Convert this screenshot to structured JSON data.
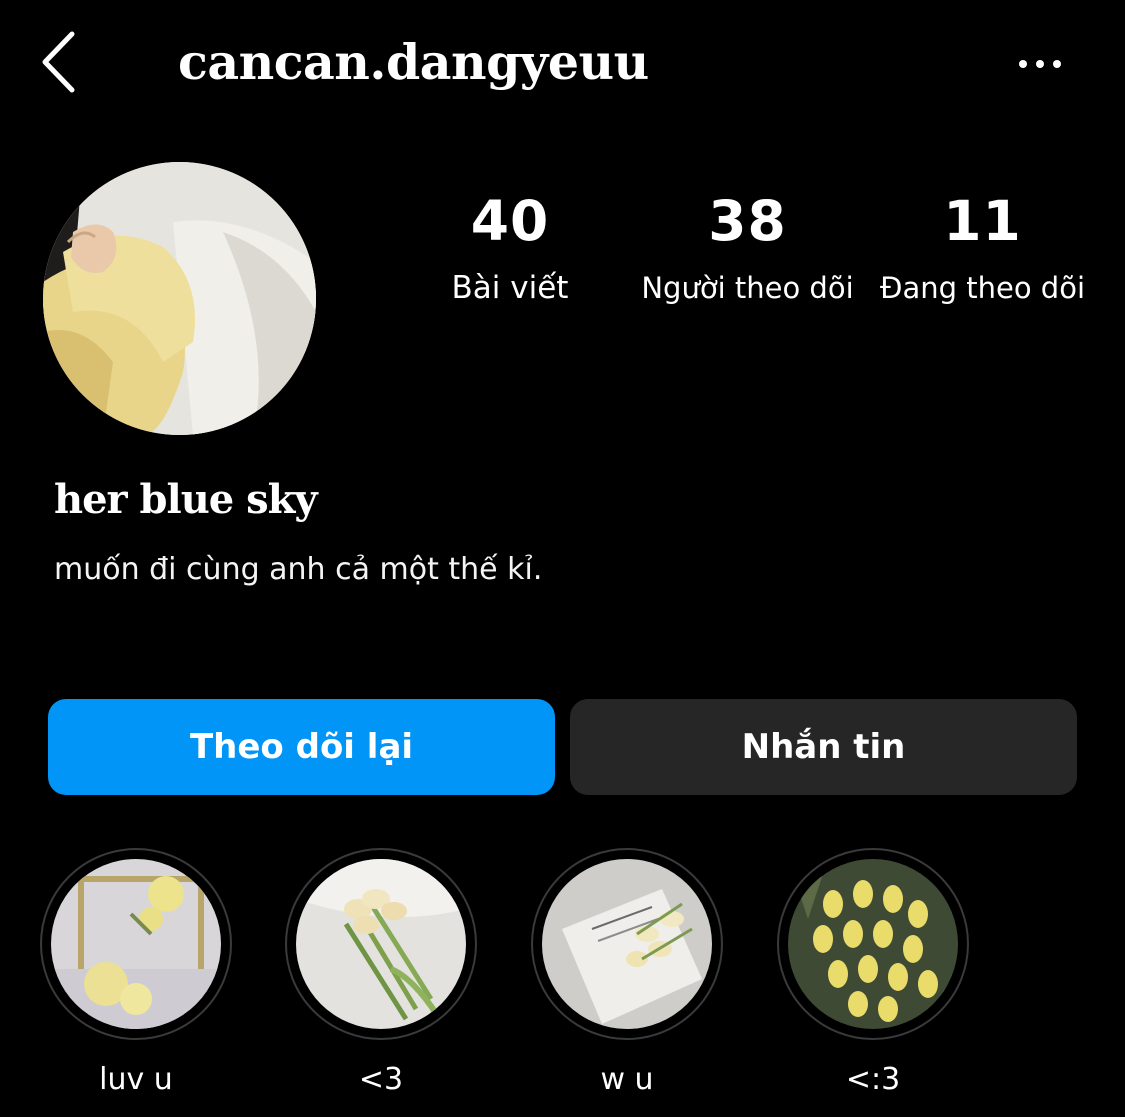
{
  "header": {
    "username": "cancan.dangyeuu",
    "back_icon": "chevron-left-icon",
    "more_icon": "ellipsis-icon"
  },
  "profile": {
    "avatar_icon": "profile-photo",
    "stats": [
      {
        "value": "40",
        "label": "Bài viết"
      },
      {
        "value": "38",
        "label": "Người theo dõi"
      },
      {
        "value": "11",
        "label": "Đang theo dõi"
      }
    ],
    "display_name": "her blue sky",
    "bio": "muốn đi cùng anh cả một thế kỉ."
  },
  "actions": {
    "follow_back_label": "Theo dõi lại",
    "message_label": "Nhắn tin"
  },
  "highlights": [
    {
      "label": "luv u"
    },
    {
      "label": "<3"
    },
    {
      "label": "w u"
    },
    {
      "label": "<:3"
    }
  ],
  "colors": {
    "background": "#000000",
    "primary_button": "#0095f6",
    "secondary_button": "#262626",
    "text": "#ffffff"
  }
}
